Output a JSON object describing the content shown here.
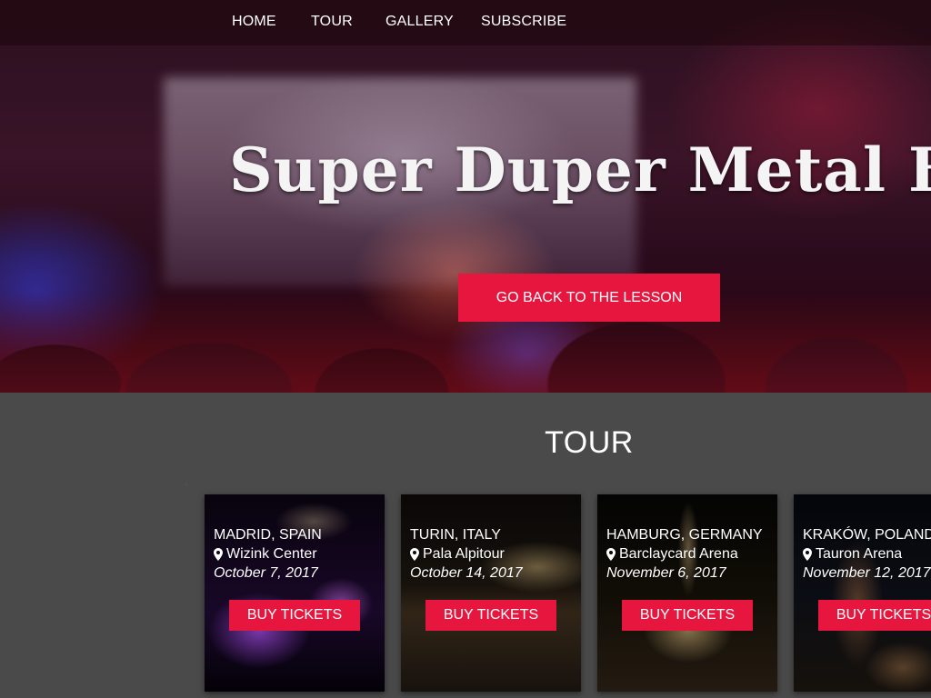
{
  "nav": {
    "items": [
      {
        "label": "HOME"
      },
      {
        "label": "TOUR"
      },
      {
        "label": "GALLERY"
      },
      {
        "label": "SUBSCRIBE"
      }
    ]
  },
  "hero": {
    "title": "Super Duper Metal Band",
    "cta_label": "GO BACK TO THE LESSON"
  },
  "tour": {
    "heading": "TOUR",
    "cards": [
      {
        "city": "MADRID, SPAIN",
        "venue": "Wizink Center",
        "date": "October 7, 2017",
        "button": "BUY TICKETS"
      },
      {
        "city": "TURIN, ITALY",
        "venue": "Pala Alpitour",
        "date": "October 14, 2017",
        "button": "BUY TICKETS"
      },
      {
        "city": "HAMBURG, GERMANY",
        "venue": "Barclaycard Arena",
        "date": "November 6, 2017",
        "button": "BUY TICKETS"
      },
      {
        "city": "KRAKÓW, POLAND",
        "venue": "Tauron Arena",
        "date": "November 12, 2017",
        "button": "BUY TICKETS"
      }
    ]
  },
  "colors": {
    "accent": "#e6163f",
    "section_bg": "#4a4a4a"
  },
  "icons": {
    "venue": "map-marker-icon"
  }
}
